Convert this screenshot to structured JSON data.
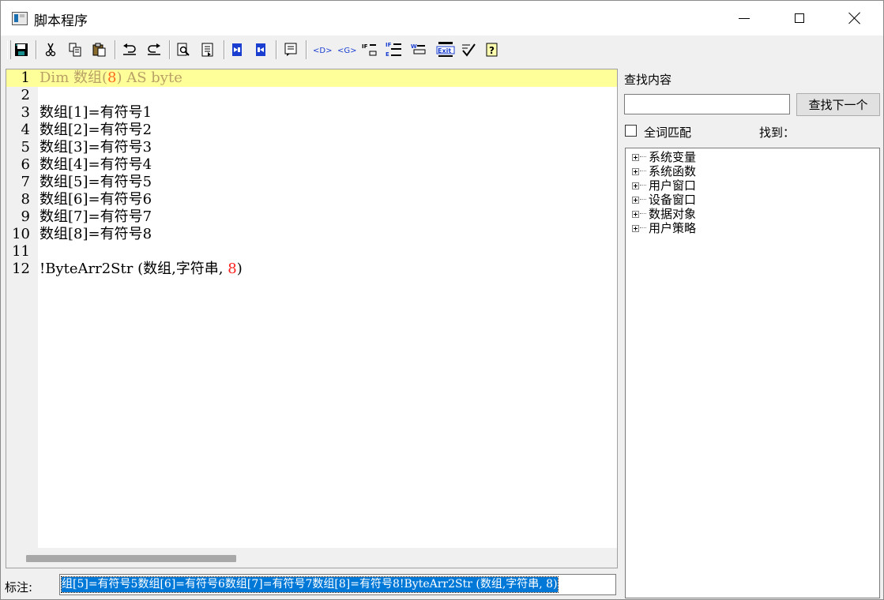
{
  "window": {
    "title": "脚本程序"
  },
  "editor": {
    "lines": [
      {
        "n": "1",
        "parts": [
          {
            "t": "Dim 数组(",
            "c": "kw"
          },
          {
            "t": "8",
            "c": "kwnum"
          },
          {
            "t": ") AS byte",
            "c": "kw"
          }
        ],
        "current": true
      },
      {
        "n": "2",
        "parts": []
      },
      {
        "n": "3",
        "parts": [
          {
            "t": "数组[1]=有符号1",
            "c": ""
          }
        ]
      },
      {
        "n": "4",
        "parts": [
          {
            "t": "数组[2]=有符号2",
            "c": ""
          }
        ]
      },
      {
        "n": "5",
        "parts": [
          {
            "t": "数组[3]=有符号3",
            "c": ""
          }
        ]
      },
      {
        "n": "6",
        "parts": [
          {
            "t": "数组[4]=有符号4",
            "c": ""
          }
        ]
      },
      {
        "n": "7",
        "parts": [
          {
            "t": "数组[5]=有符号5",
            "c": ""
          }
        ]
      },
      {
        "n": "8",
        "parts": [
          {
            "t": "数组[6]=有符号6",
            "c": ""
          }
        ]
      },
      {
        "n": "9",
        "parts": [
          {
            "t": "数组[7]=有符号7",
            "c": ""
          }
        ]
      },
      {
        "n": "10",
        "parts": [
          {
            "t": "数组[8]=有符号8",
            "c": ""
          }
        ]
      },
      {
        "n": "11",
        "parts": []
      },
      {
        "n": "12",
        "parts": [
          {
            "t": "!ByteArr2Str (数组,字符串, ",
            "c": ""
          },
          {
            "t": "8",
            "c": "num"
          },
          {
            "t": ")",
            "c": ""
          }
        ]
      }
    ]
  },
  "find": {
    "label": "查找内容",
    "value": "",
    "button": "查找下一个",
    "whole_word": "全词匹配",
    "found": "找到："
  },
  "tree": [
    "系统变量",
    "系统函数",
    "用户窗口",
    "设备窗口",
    "数据对象",
    "用户策略"
  ],
  "note": {
    "label": "标注:",
    "value": "组[5]=有符号5数组[6]=有符号6数组[7]=有符号7数组[8]=有符号8!ByteArr2Str (数组,字符串, 8)"
  },
  "toolbar_icons": [
    "save-icon",
    "cut-icon",
    "copy-icon",
    "paste-icon",
    "undo-icon",
    "redo-icon",
    "find-icon",
    "replace-icon",
    "indent-icon",
    "outdent-icon",
    "comment-icon",
    "insert-d-icon",
    "insert-g-icon",
    "if-then-icon",
    "if-else-icon",
    "while-icon",
    "exit-icon",
    "check-icon",
    "help-icon"
  ],
  "colors": {
    "keyword": "#b9a066",
    "number": "#ff2020",
    "current_line": "#ffff99",
    "selection": "#0078d7"
  }
}
